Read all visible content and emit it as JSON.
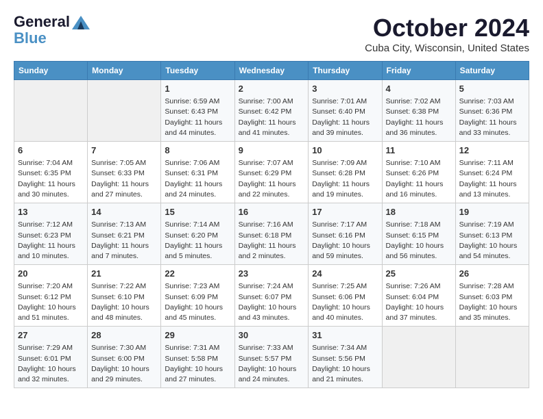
{
  "header": {
    "logo_line1": "General",
    "logo_line2": "Blue",
    "month": "October 2024",
    "location": "Cuba City, Wisconsin, United States"
  },
  "weekdays": [
    "Sunday",
    "Monday",
    "Tuesday",
    "Wednesday",
    "Thursday",
    "Friday",
    "Saturday"
  ],
  "weeks": [
    [
      {
        "day": "",
        "sunrise": "",
        "sunset": "",
        "daylight": ""
      },
      {
        "day": "",
        "sunrise": "",
        "sunset": "",
        "daylight": ""
      },
      {
        "day": "1",
        "sunrise": "Sunrise: 6:59 AM",
        "sunset": "Sunset: 6:43 PM",
        "daylight": "Daylight: 11 hours and 44 minutes."
      },
      {
        "day": "2",
        "sunrise": "Sunrise: 7:00 AM",
        "sunset": "Sunset: 6:42 PM",
        "daylight": "Daylight: 11 hours and 41 minutes."
      },
      {
        "day": "3",
        "sunrise": "Sunrise: 7:01 AM",
        "sunset": "Sunset: 6:40 PM",
        "daylight": "Daylight: 11 hours and 39 minutes."
      },
      {
        "day": "4",
        "sunrise": "Sunrise: 7:02 AM",
        "sunset": "Sunset: 6:38 PM",
        "daylight": "Daylight: 11 hours and 36 minutes."
      },
      {
        "day": "5",
        "sunrise": "Sunrise: 7:03 AM",
        "sunset": "Sunset: 6:36 PM",
        "daylight": "Daylight: 11 hours and 33 minutes."
      }
    ],
    [
      {
        "day": "6",
        "sunrise": "Sunrise: 7:04 AM",
        "sunset": "Sunset: 6:35 PM",
        "daylight": "Daylight: 11 hours and 30 minutes."
      },
      {
        "day": "7",
        "sunrise": "Sunrise: 7:05 AM",
        "sunset": "Sunset: 6:33 PM",
        "daylight": "Daylight: 11 hours and 27 minutes."
      },
      {
        "day": "8",
        "sunrise": "Sunrise: 7:06 AM",
        "sunset": "Sunset: 6:31 PM",
        "daylight": "Daylight: 11 hours and 24 minutes."
      },
      {
        "day": "9",
        "sunrise": "Sunrise: 7:07 AM",
        "sunset": "Sunset: 6:29 PM",
        "daylight": "Daylight: 11 hours and 22 minutes."
      },
      {
        "day": "10",
        "sunrise": "Sunrise: 7:09 AM",
        "sunset": "Sunset: 6:28 PM",
        "daylight": "Daylight: 11 hours and 19 minutes."
      },
      {
        "day": "11",
        "sunrise": "Sunrise: 7:10 AM",
        "sunset": "Sunset: 6:26 PM",
        "daylight": "Daylight: 11 hours and 16 minutes."
      },
      {
        "day": "12",
        "sunrise": "Sunrise: 7:11 AM",
        "sunset": "Sunset: 6:24 PM",
        "daylight": "Daylight: 11 hours and 13 minutes."
      }
    ],
    [
      {
        "day": "13",
        "sunrise": "Sunrise: 7:12 AM",
        "sunset": "Sunset: 6:23 PM",
        "daylight": "Daylight: 11 hours and 10 minutes."
      },
      {
        "day": "14",
        "sunrise": "Sunrise: 7:13 AM",
        "sunset": "Sunset: 6:21 PM",
        "daylight": "Daylight: 11 hours and 7 minutes."
      },
      {
        "day": "15",
        "sunrise": "Sunrise: 7:14 AM",
        "sunset": "Sunset: 6:20 PM",
        "daylight": "Daylight: 11 hours and 5 minutes."
      },
      {
        "day": "16",
        "sunrise": "Sunrise: 7:16 AM",
        "sunset": "Sunset: 6:18 PM",
        "daylight": "Daylight: 11 hours and 2 minutes."
      },
      {
        "day": "17",
        "sunrise": "Sunrise: 7:17 AM",
        "sunset": "Sunset: 6:16 PM",
        "daylight": "Daylight: 10 hours and 59 minutes."
      },
      {
        "day": "18",
        "sunrise": "Sunrise: 7:18 AM",
        "sunset": "Sunset: 6:15 PM",
        "daylight": "Daylight: 10 hours and 56 minutes."
      },
      {
        "day": "19",
        "sunrise": "Sunrise: 7:19 AM",
        "sunset": "Sunset: 6:13 PM",
        "daylight": "Daylight: 10 hours and 54 minutes."
      }
    ],
    [
      {
        "day": "20",
        "sunrise": "Sunrise: 7:20 AM",
        "sunset": "Sunset: 6:12 PM",
        "daylight": "Daylight: 10 hours and 51 minutes."
      },
      {
        "day": "21",
        "sunrise": "Sunrise: 7:22 AM",
        "sunset": "Sunset: 6:10 PM",
        "daylight": "Daylight: 10 hours and 48 minutes."
      },
      {
        "day": "22",
        "sunrise": "Sunrise: 7:23 AM",
        "sunset": "Sunset: 6:09 PM",
        "daylight": "Daylight: 10 hours and 45 minutes."
      },
      {
        "day": "23",
        "sunrise": "Sunrise: 7:24 AM",
        "sunset": "Sunset: 6:07 PM",
        "daylight": "Daylight: 10 hours and 43 minutes."
      },
      {
        "day": "24",
        "sunrise": "Sunrise: 7:25 AM",
        "sunset": "Sunset: 6:06 PM",
        "daylight": "Daylight: 10 hours and 40 minutes."
      },
      {
        "day": "25",
        "sunrise": "Sunrise: 7:26 AM",
        "sunset": "Sunset: 6:04 PM",
        "daylight": "Daylight: 10 hours and 37 minutes."
      },
      {
        "day": "26",
        "sunrise": "Sunrise: 7:28 AM",
        "sunset": "Sunset: 6:03 PM",
        "daylight": "Daylight: 10 hours and 35 minutes."
      }
    ],
    [
      {
        "day": "27",
        "sunrise": "Sunrise: 7:29 AM",
        "sunset": "Sunset: 6:01 PM",
        "daylight": "Daylight: 10 hours and 32 minutes."
      },
      {
        "day": "28",
        "sunrise": "Sunrise: 7:30 AM",
        "sunset": "Sunset: 6:00 PM",
        "daylight": "Daylight: 10 hours and 29 minutes."
      },
      {
        "day": "29",
        "sunrise": "Sunrise: 7:31 AM",
        "sunset": "Sunset: 5:58 PM",
        "daylight": "Daylight: 10 hours and 27 minutes."
      },
      {
        "day": "30",
        "sunrise": "Sunrise: 7:33 AM",
        "sunset": "Sunset: 5:57 PM",
        "daylight": "Daylight: 10 hours and 24 minutes."
      },
      {
        "day": "31",
        "sunrise": "Sunrise: 7:34 AM",
        "sunset": "Sunset: 5:56 PM",
        "daylight": "Daylight: 10 hours and 21 minutes."
      },
      {
        "day": "",
        "sunrise": "",
        "sunset": "",
        "daylight": ""
      },
      {
        "day": "",
        "sunrise": "",
        "sunset": "",
        "daylight": ""
      }
    ]
  ]
}
